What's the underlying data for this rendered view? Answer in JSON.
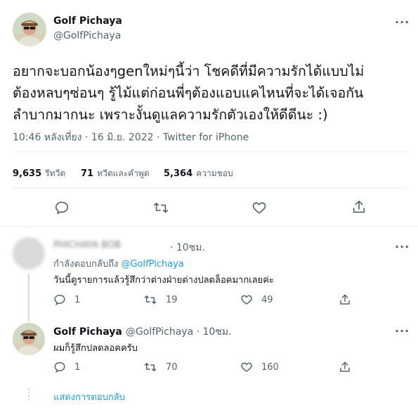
{
  "tweet": {
    "author_name": "Golf Pichaya",
    "author_handle": "@GolfPichaya",
    "text_lines": [
      "อยากจะบอกน้องๆgenใหม่ๆนี้ว่า โชคดีที่มีความรักได้แบบไม่",
      "ต้องหลบๆซ่อนๆ รู้ไม้แต่ก่อนพี่ๆต้องแอบแคไหนที่จะได้เจอกัน",
      "ลำบากมากนะ เพราะงั้นดูแลความรักตัวเองให้ดีดีนะ :)"
    ],
    "timestamp": "10:46 หลังเที่ยง · 16 มิ.ย. 2022 · Twitter for iPhone",
    "stats": {
      "retweets_num": "9,635",
      "retweets_label": "รีทวีต",
      "quotes_num": "71",
      "quotes_label": "ทวีตและคำพูด",
      "likes_num": "5,364",
      "likes_label": "ความชอบ"
    }
  },
  "replies": [
    {
      "name_blurred": "PHICHAYA BOB",
      "time": "· 10ชม.",
      "replying_prefix": "กำลังตอบกลับถึง",
      "replying_to": "@GolfPichaya",
      "text": "วันนี้ดูรายการแล้วรู้สึกว่าต่างฝ่ายต่างปลดล็อคมากเลยค่ะ",
      "reply_count": "1",
      "retweet_count": "19",
      "like_count": "49"
    },
    {
      "name": "Golf Pichaya",
      "handle_time": "@GolfPichaya · 10ชม.",
      "text": "ผมก็รู้สึกปลดลอคครับ",
      "reply_count": "1",
      "retweet_count": "70",
      "like_count": "160"
    }
  ],
  "show_replies": "แสดงการตอบกลับ",
  "more_glyph": "···"
}
